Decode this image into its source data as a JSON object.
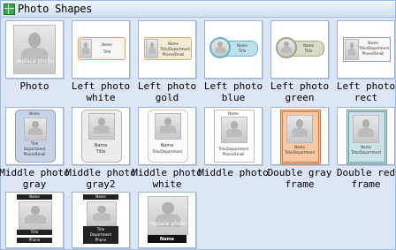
{
  "header": {
    "title": "Photo Shapes",
    "icon": "shapes-grid-icon"
  },
  "shapes": [
    {
      "label": "Photo"
    },
    {
      "label": "Left photo white"
    },
    {
      "label": "Left photo gold"
    },
    {
      "label": "Left photo blue"
    },
    {
      "label": "Left photo green"
    },
    {
      "label": "Left photo rect"
    },
    {
      "label": "Middle photo gray"
    },
    {
      "label": "Middle photo gray2"
    },
    {
      "label": "Middle photo white"
    },
    {
      "label": "Middle photo"
    },
    {
      "label": "Double gray frame"
    },
    {
      "label": "Double red frame"
    },
    {
      "label": ""
    },
    {
      "label": ""
    },
    {
      "label": ""
    }
  ],
  "thumb_text": {
    "replace_photo": "replace photo",
    "name": "Name",
    "title": "Title",
    "title_department": "Title/Department",
    "phone_email": "Phone/Email",
    "department": "Department",
    "phone": "Phone"
  },
  "colors": {
    "accent_gold": "#e7b861",
    "accent_blue": "#5bb3d6",
    "accent_green": "#9aa882",
    "accent_orange": "#e08a3a",
    "accent_red": "#7aa9b3"
  }
}
